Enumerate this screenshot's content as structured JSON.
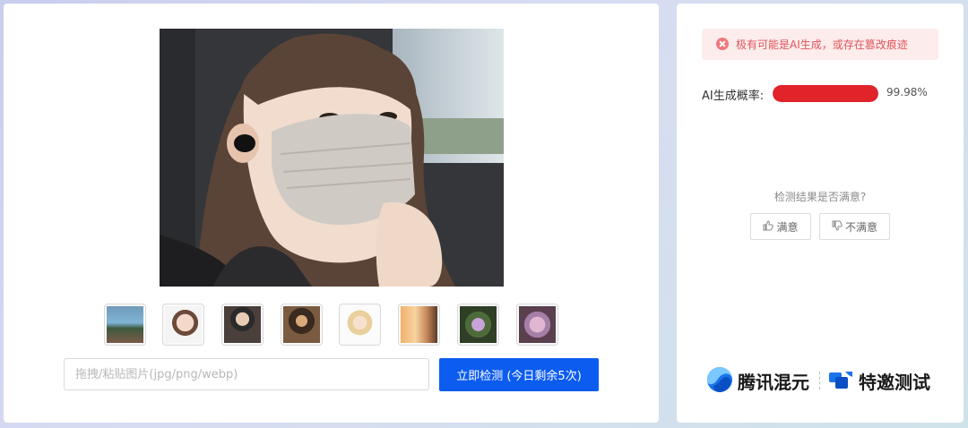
{
  "thumbnails": [
    {
      "label": "sample-1"
    },
    {
      "label": "sample-2"
    },
    {
      "label": "sample-3"
    },
    {
      "label": "sample-4"
    },
    {
      "label": "sample-5"
    },
    {
      "label": "sample-6"
    },
    {
      "label": "sample-7"
    },
    {
      "label": "sample-8"
    }
  ],
  "upload": {
    "placeholder": "拖拽/粘贴图片(jpg/png/webp)",
    "button_label": "立即检测 (今日剩余5次)"
  },
  "result": {
    "alert_text": "极有可能是AI生成，或存在篡改痕迹",
    "prob_label": "AI生成概率:",
    "prob_value": "99.98%",
    "prob_fraction": 0.9998,
    "status_color": "#e0242a"
  },
  "feedback": {
    "question": "检测结果是否满意?",
    "satisfied": "满意",
    "unsatisfied": "不满意"
  },
  "brand": {
    "name": "腾讯混元",
    "invite": "特邀测试"
  },
  "icons": {
    "alert": "close-circle-icon",
    "satisfied": "thumbs-up-icon",
    "unsatisfied": "thumbs-down-icon",
    "brand": "hunyuan-logo-icon",
    "invite": "invite-badge-icon"
  }
}
